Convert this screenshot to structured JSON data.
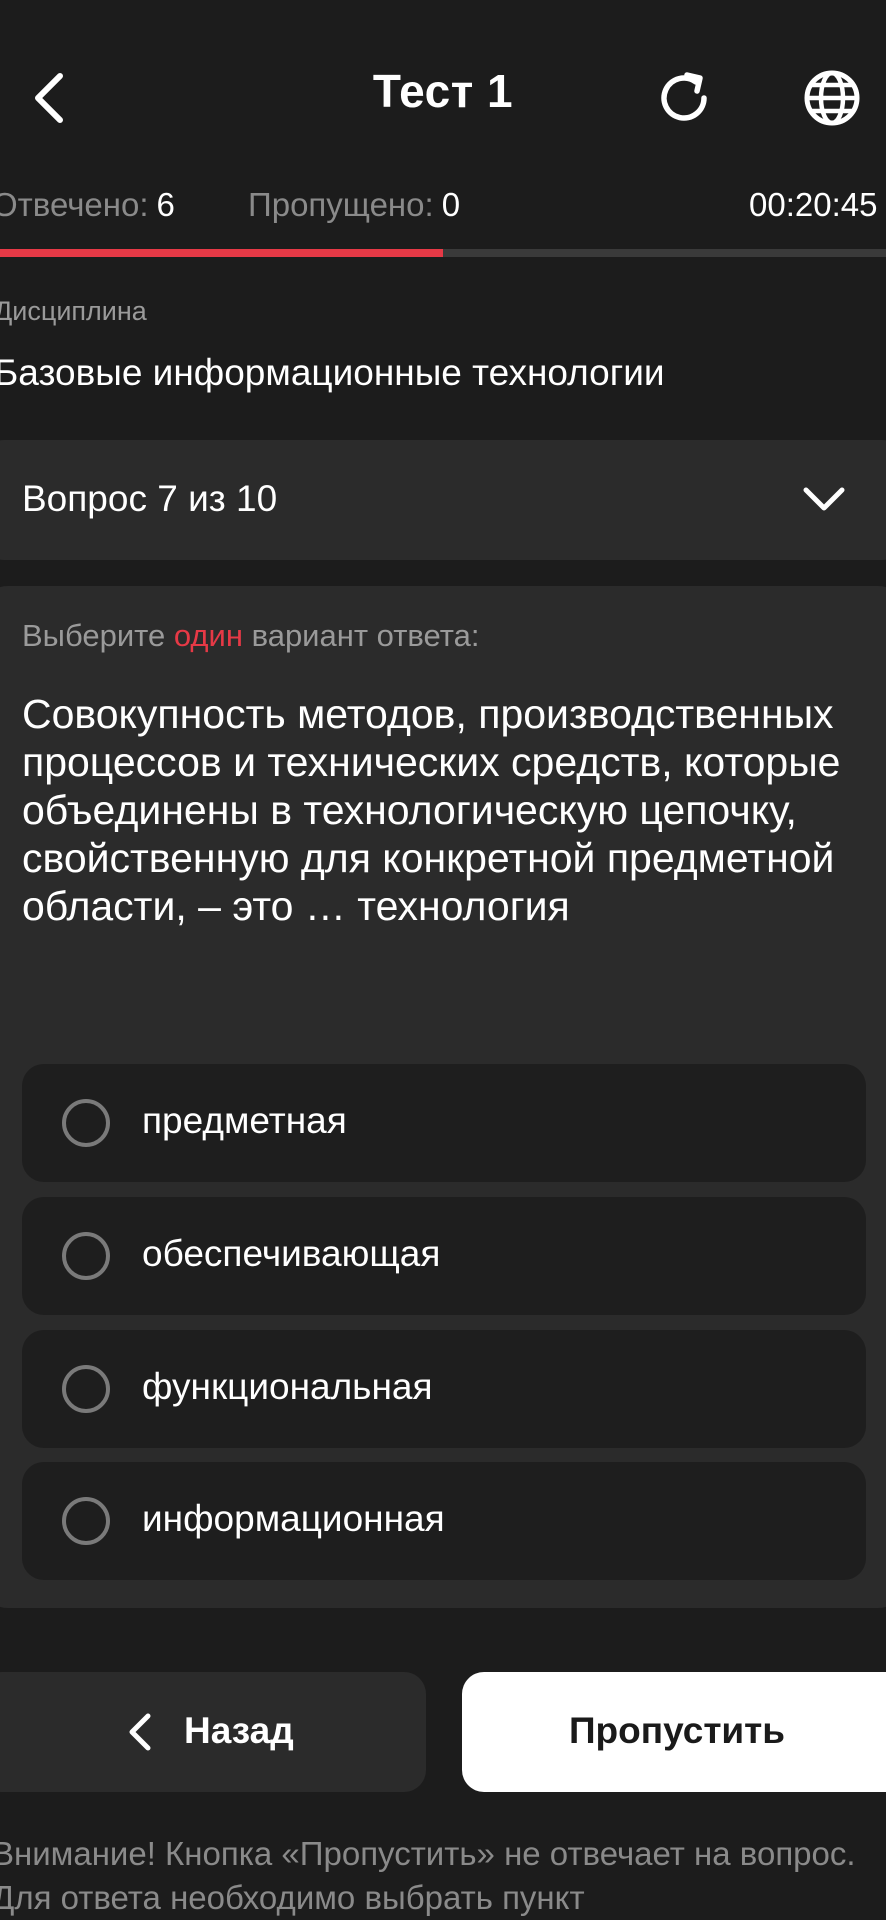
{
  "header": {
    "title": "Тест 1",
    "icons": {
      "back": "back-arrow-icon",
      "refresh": "refresh-icon",
      "language": "globe-icon"
    }
  },
  "stats": {
    "answered_label": "Отвечено:",
    "answered_value": "6",
    "skipped_label": "Пропущено:",
    "skipped_value": "0",
    "timer": "00:20:45",
    "progress_fraction": 0.5
  },
  "discipline": {
    "label": "Дисциплина",
    "name": "Базовые информационные технологии"
  },
  "question_selector": {
    "text": "Вопрос 7 из 10"
  },
  "question": {
    "instruction_prefix": "Выберите ",
    "instruction_accent": "один",
    "instruction_suffix": " вариант ответа:",
    "text": "Совокупность методов, производственных процессов и технических средств, которые объединены в технологическую цепочку, свойственную для конкретной предметной области, – это … технология",
    "options": [
      {
        "label": "предметная"
      },
      {
        "label": "обеспечивающая"
      },
      {
        "label": "функциональная"
      },
      {
        "label": "информационная"
      }
    ]
  },
  "buttons": {
    "back_label": "Назад",
    "skip_label": "Пропустить"
  },
  "warning": "Внимание! Кнопка «Пропустить» не отвечает на вопрос. Для ответа необходимо выбрать пункт",
  "colors": {
    "background": "#1c1c1c",
    "card": "#2b2b2b",
    "accent": "#e63946",
    "muted_text": "#8a8a8a"
  }
}
